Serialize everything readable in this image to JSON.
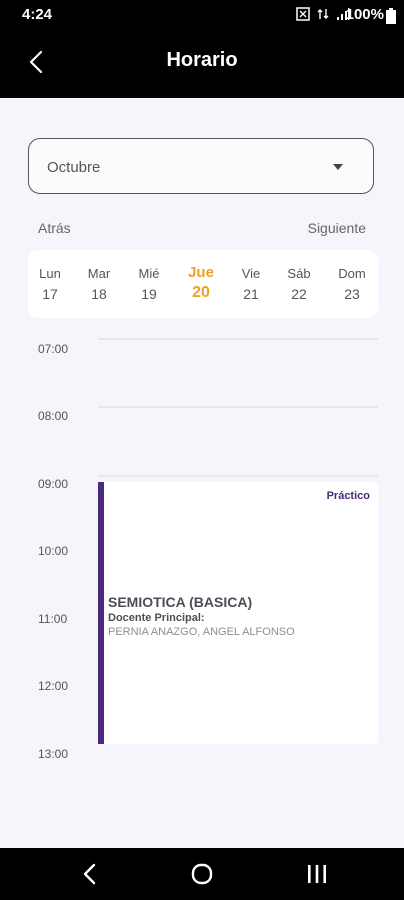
{
  "status_bar": {
    "time": "4:24",
    "battery": "100%"
  },
  "app_bar": {
    "title": "Horario"
  },
  "month_select": {
    "value": "Octubre"
  },
  "week_nav": {
    "prev_label": "Atrás",
    "next_label": "Siguiente"
  },
  "week": {
    "days": [
      {
        "name": "Lun",
        "date": "17"
      },
      {
        "name": "Mar",
        "date": "18"
      },
      {
        "name": "Mié",
        "date": "19"
      },
      {
        "name": "Jue",
        "date": "20"
      },
      {
        "name": "Vie",
        "date": "21"
      },
      {
        "name": "Sáb",
        "date": "22"
      },
      {
        "name": "Dom",
        "date": "23"
      }
    ],
    "active_color": "#f0a01e"
  },
  "timeline": {
    "hours": [
      "07:00",
      "08:00",
      "09:00",
      "10:00",
      "11:00",
      "12:00",
      "13:00"
    ]
  },
  "event": {
    "type": "Práctico",
    "course": "SEMIOTICA (BASICA)",
    "teacher_label": "Docente Principal:",
    "teacher_name": "PERNIA ANAZGO, ANGEL ALFONSO",
    "accent_color": "#4b2a7d"
  },
  "icons": {
    "back": "arrow-left-icon",
    "dropdown": "caret-down-icon",
    "nav_back": "chevron-left-icon",
    "nav_home": "circle-home-icon",
    "nav_recents": "three-bars-icon"
  }
}
